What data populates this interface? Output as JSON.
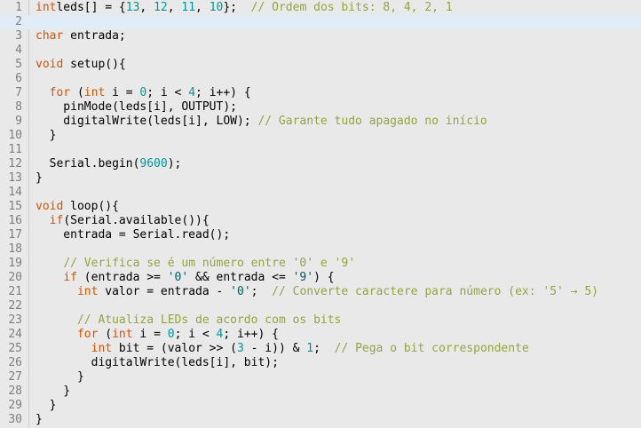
{
  "colors": {
    "background": "#e9e9e9",
    "current_line": "#e0ecf8",
    "keyword": "#d35400",
    "comment": "#95a53e",
    "number": "#00979c",
    "line_number": "#7f7f7f"
  },
  "editor": {
    "current_line": 2,
    "lines": [
      {
        "n": "1",
        "tokens": [
          [
            "kw",
            "int"
          ],
          [
            "",
            "leds[] = {"
          ],
          [
            "num",
            "13"
          ],
          [
            "",
            ", "
          ],
          [
            "num",
            "12"
          ],
          [
            "",
            ", "
          ],
          [
            "num",
            "11"
          ],
          [
            "",
            ", "
          ],
          [
            "num",
            "10"
          ],
          [
            "",
            "};  "
          ],
          [
            "cm",
            "// Ordem dos bits: 8, 4, 2, 1"
          ]
        ]
      },
      {
        "n": "2",
        "tokens": []
      },
      {
        "n": "3",
        "tokens": [
          [
            "kw",
            "char"
          ],
          [
            "fn",
            " entrada;"
          ]
        ]
      },
      {
        "n": "4",
        "tokens": []
      },
      {
        "n": "5",
        "tokens": [
          [
            "kw",
            "void"
          ],
          [
            "fn",
            " setup(){"
          ]
        ]
      },
      {
        "n": "6",
        "tokens": []
      },
      {
        "n": "7",
        "tokens": [
          [
            "",
            "  "
          ],
          [
            "kw",
            "for"
          ],
          [
            "",
            " ("
          ],
          [
            "kw",
            "int"
          ],
          [
            "",
            " i = "
          ],
          [
            "num",
            "0"
          ],
          [
            "",
            "; i < "
          ],
          [
            "num",
            "4"
          ],
          [
            "",
            "; i++) {"
          ]
        ]
      },
      {
        "n": "8",
        "tokens": [
          [
            "",
            "    pinMode(leds[i], OUTPUT);"
          ]
        ]
      },
      {
        "n": "9",
        "tokens": [
          [
            "",
            "    digitalWrite(leds[i], LOW); "
          ],
          [
            "cm",
            "// Garante tudo apagado no início"
          ]
        ]
      },
      {
        "n": "10",
        "tokens": [
          [
            "",
            "  }"
          ]
        ]
      },
      {
        "n": "11",
        "tokens": []
      },
      {
        "n": "12",
        "tokens": [
          [
            "",
            "  Serial.begin("
          ],
          [
            "num",
            "9600"
          ],
          [
            "",
            ");"
          ]
        ]
      },
      {
        "n": "13",
        "tokens": [
          [
            "",
            "}"
          ]
        ]
      },
      {
        "n": "14",
        "tokens": []
      },
      {
        "n": "15",
        "tokens": [
          [
            "kw",
            "void"
          ],
          [
            "",
            " loop(){"
          ]
        ]
      },
      {
        "n": "16",
        "tokens": [
          [
            "",
            "  "
          ],
          [
            "kw",
            "if"
          ],
          [
            "",
            "(Serial.available()){"
          ]
        ]
      },
      {
        "n": "17",
        "tokens": [
          [
            "",
            "    entrada = Serial.read();"
          ]
        ]
      },
      {
        "n": "18",
        "tokens": []
      },
      {
        "n": "19",
        "tokens": [
          [
            "",
            "    "
          ],
          [
            "cm",
            "// Verifica se é um número entre '0' e '9'"
          ]
        ]
      },
      {
        "n": "20",
        "tokens": [
          [
            "",
            "    "
          ],
          [
            "kw",
            "if"
          ],
          [
            "",
            " (entrada >= "
          ],
          [
            "str",
            "'0'"
          ],
          [
            "",
            " && entrada <= "
          ],
          [
            "str",
            "'9'"
          ],
          [
            "",
            ") {"
          ]
        ]
      },
      {
        "n": "21",
        "tokens": [
          [
            "",
            "      "
          ],
          [
            "kw",
            "int"
          ],
          [
            "",
            " valor = entrada - "
          ],
          [
            "str",
            "'0'"
          ],
          [
            "",
            ";  "
          ],
          [
            "cm",
            "// Converte caractere para número (ex: '5' → 5)"
          ]
        ]
      },
      {
        "n": "22",
        "tokens": []
      },
      {
        "n": "23",
        "tokens": [
          [
            "",
            "      "
          ],
          [
            "cm",
            "// Atualiza LEDs de acordo com os bits"
          ]
        ]
      },
      {
        "n": "24",
        "tokens": [
          [
            "",
            "      "
          ],
          [
            "kw",
            "for"
          ],
          [
            "",
            " ("
          ],
          [
            "kw",
            "int"
          ],
          [
            "",
            " i = "
          ],
          [
            "num",
            "0"
          ],
          [
            "",
            "; i < "
          ],
          [
            "num",
            "4"
          ],
          [
            "",
            "; i++) {"
          ]
        ]
      },
      {
        "n": "25",
        "tokens": [
          [
            "",
            "        "
          ],
          [
            "kw",
            "int"
          ],
          [
            "",
            " bit = (valor >> ("
          ],
          [
            "num",
            "3"
          ],
          [
            "",
            " - i)) & "
          ],
          [
            "num",
            "1"
          ],
          [
            "",
            ";  "
          ],
          [
            "cm",
            "// Pega o bit correspondente"
          ]
        ]
      },
      {
        "n": "26",
        "tokens": [
          [
            "",
            "        digitalWrite(leds[i], bit);"
          ]
        ]
      },
      {
        "n": "27",
        "tokens": [
          [
            "",
            "      }"
          ]
        ]
      },
      {
        "n": "28",
        "tokens": [
          [
            "",
            "    }"
          ]
        ]
      },
      {
        "n": "29",
        "tokens": [
          [
            "",
            "  }"
          ]
        ]
      },
      {
        "n": "30",
        "tokens": [
          [
            "",
            "}"
          ]
        ]
      }
    ]
  }
}
